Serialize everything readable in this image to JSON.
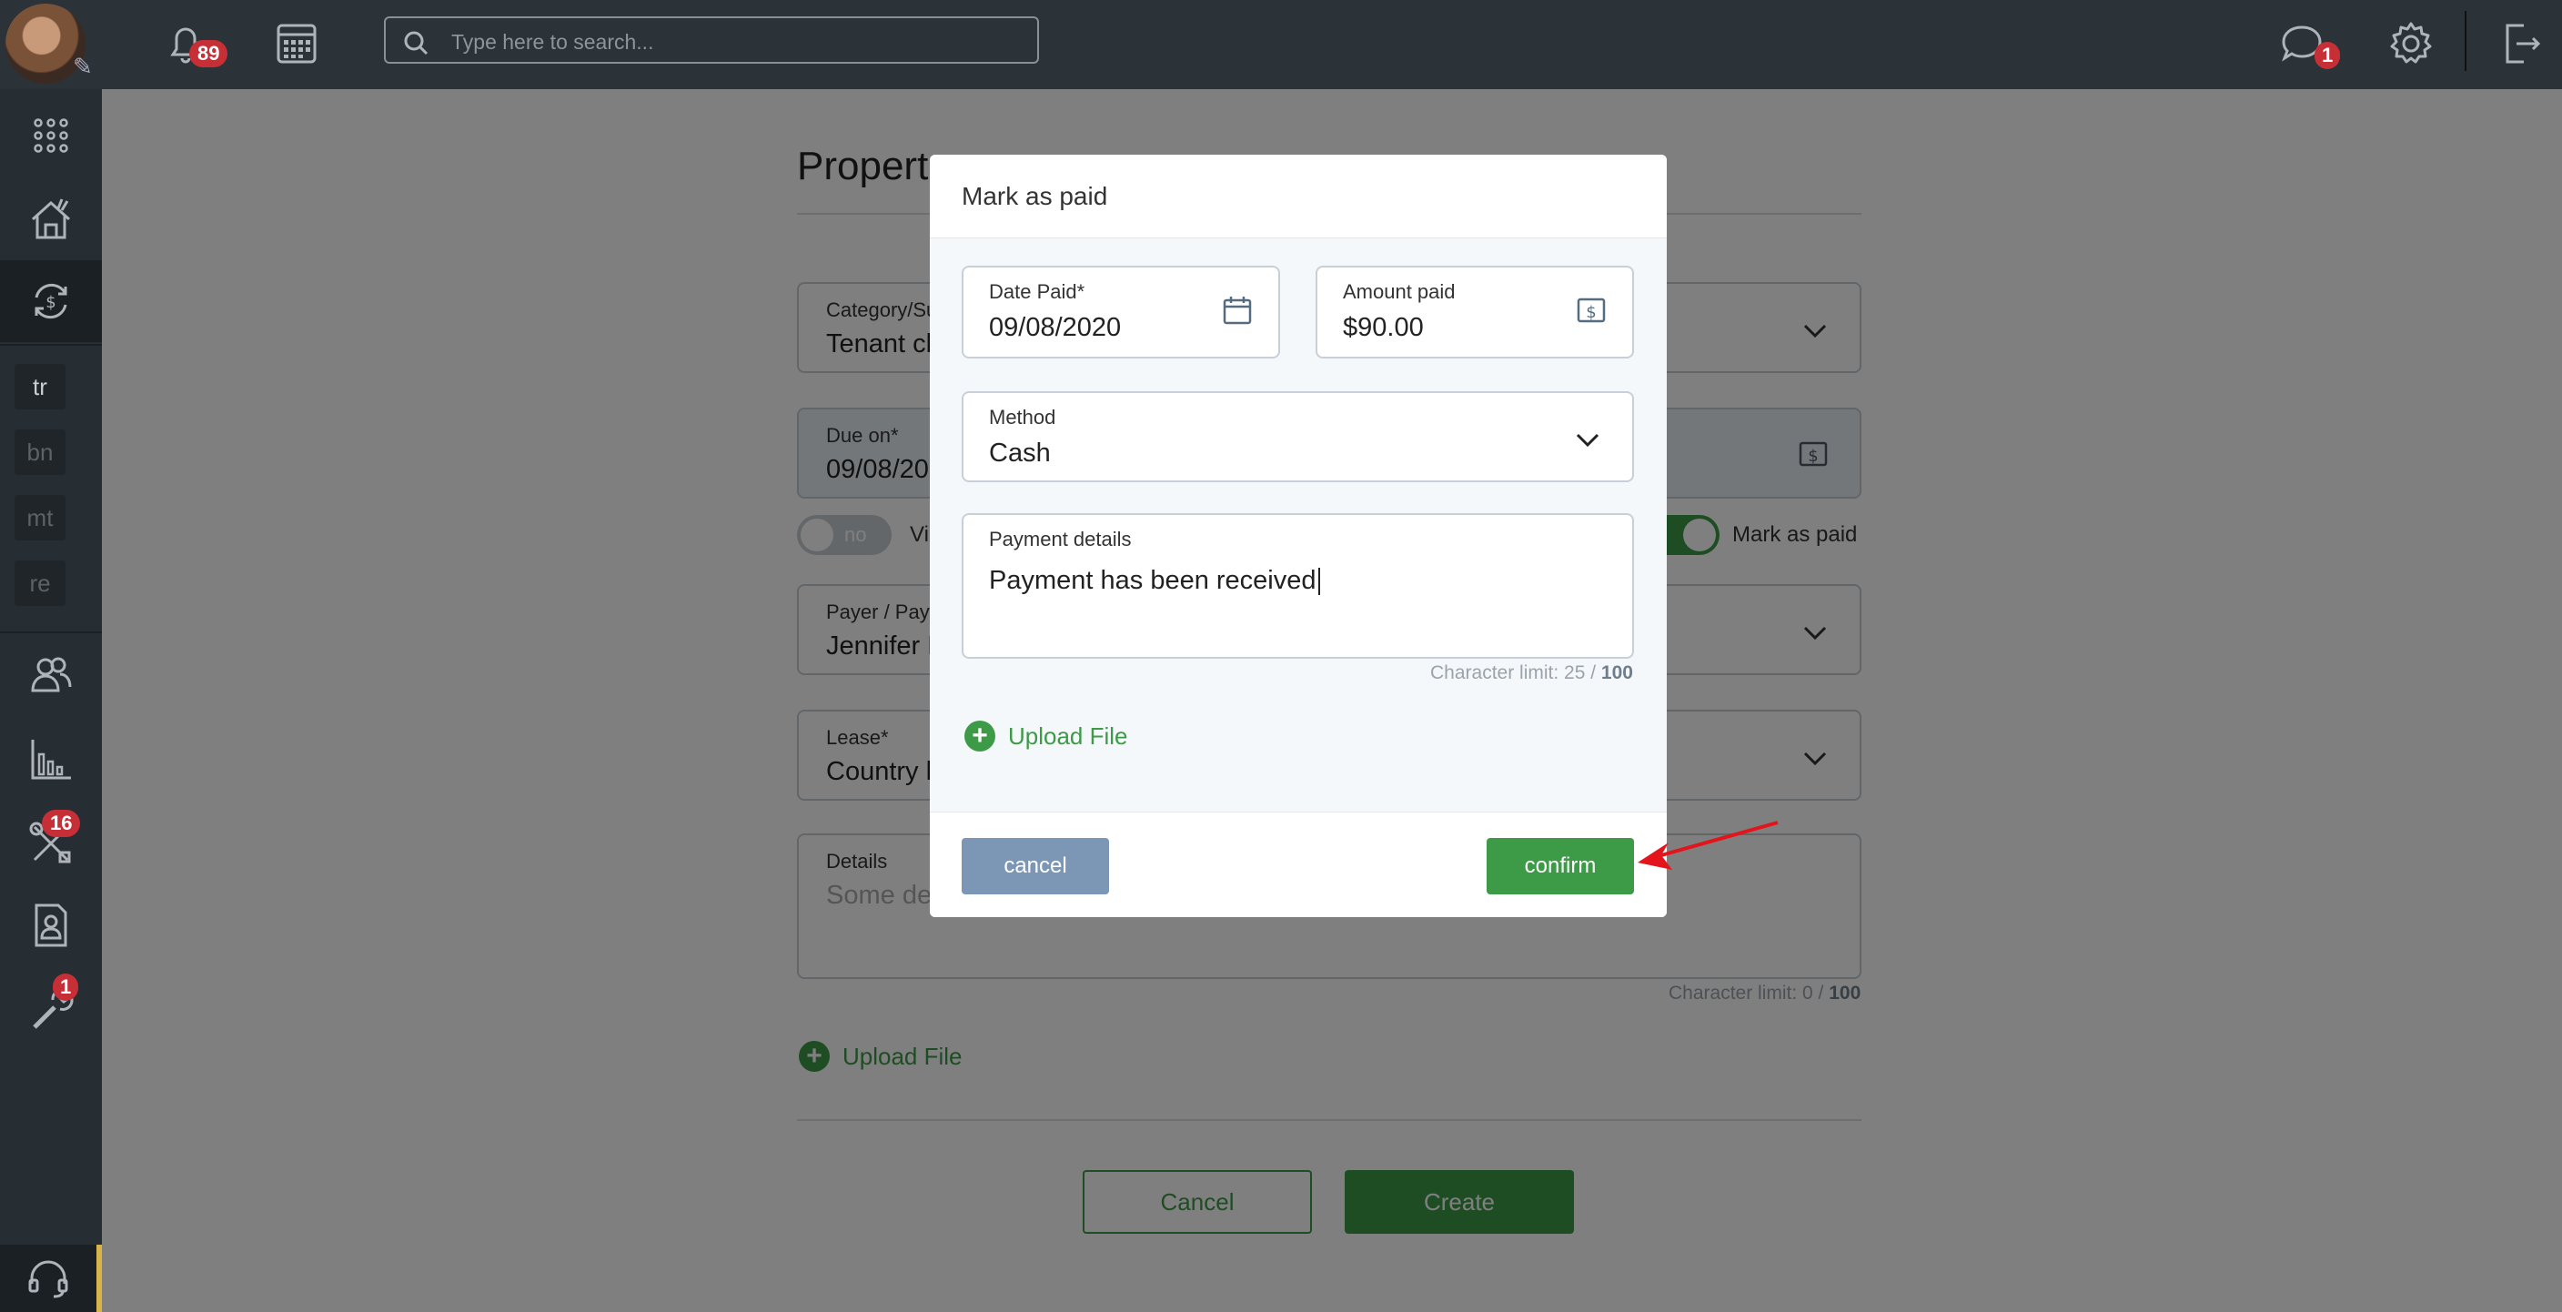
{
  "topbar": {
    "notifications_count": "89",
    "messages_count": "1",
    "search_placeholder": "Type here to search..."
  },
  "sidebar": {
    "abbreviations": [
      "tr",
      "bn",
      "mt",
      "re"
    ],
    "maintenance_badge": "16",
    "tools_badge": "1"
  },
  "background_form": {
    "title": "Propert",
    "category_label": "Category/Su",
    "category_value": "Tenant ch",
    "due_label": "Due on*",
    "due_value": "09/08/20",
    "toggle_no_label": "no",
    "toggle_left_text": "Vi",
    "toggle_right_label": "Mark as paid",
    "payer_label": "Payer / Paye",
    "payer_value": "Jennifer F",
    "lease_label": "Lease*",
    "lease_value": "Country h",
    "details_label": "Details",
    "details_placeholder": "Some de",
    "char_limit_prefix": "Character limit: 0 / ",
    "char_limit_max": "100",
    "upload_label": "Upload File",
    "cancel_label": "Cancel",
    "create_label": "Create"
  },
  "modal": {
    "title": "Mark as paid",
    "date_paid_label": "Date Paid*",
    "date_paid_value": "09/08/2020",
    "amount_label": "Amount paid",
    "amount_value": "$90.00",
    "method_label": "Method",
    "method_value": "Cash",
    "details_label": "Payment details",
    "details_value": "Payment has been received",
    "char_limit_prefix": "Character limit: 25 / ",
    "char_limit_max": "100",
    "upload_label": "Upload File",
    "cancel_label": "cancel",
    "confirm_label": "confirm"
  },
  "colors": {
    "topbar": "#2b3238",
    "sidebar": "#262d33",
    "accent_green": "#3d9a47",
    "cancel_blue": "#7c97b6",
    "badge_red": "#c62f36",
    "arrow_red": "#e3141b"
  }
}
